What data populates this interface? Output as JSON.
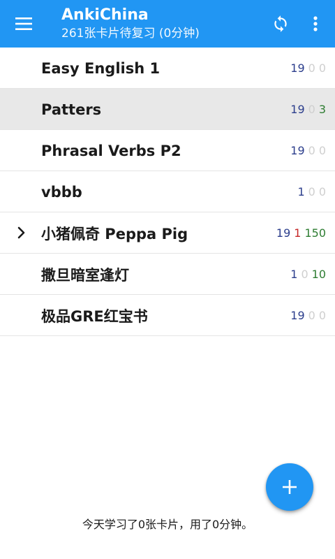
{
  "toolbar": {
    "title": "AnkiChina",
    "subtitle": "261张卡片待复习 (0分钟)",
    "color": "#2196f3"
  },
  "icons": {
    "menu": "hamburger-menu-icon",
    "sync": "sync-icon",
    "more": "more-vert-icon",
    "expand": "chevron-right-icon",
    "add": "plus-icon"
  },
  "decks": [
    {
      "name": "Easy English 1",
      "new": "19",
      "learn": "0",
      "review": "0",
      "selected": false,
      "expandable": false
    },
    {
      "name": "Patters",
      "new": "19",
      "learn": "0",
      "review": "3",
      "selected": true,
      "expandable": false
    },
    {
      "name": "Phrasal Verbs P2",
      "new": "19",
      "learn": "0",
      "review": "0",
      "selected": false,
      "expandable": false
    },
    {
      "name": "vbbb",
      "new": "1",
      "learn": "0",
      "review": "0",
      "selected": false,
      "expandable": false
    },
    {
      "name": "小猪佩奇 Peppa Pig",
      "new": "19",
      "learn": "1",
      "review": "150",
      "selected": false,
      "expandable": true
    },
    {
      "name": "撒旦暗室逢灯",
      "new": "1",
      "learn": "0",
      "review": "10",
      "selected": false,
      "expandable": false
    },
    {
      "name": "极品GRE红宝书",
      "new": "19",
      "learn": "0",
      "review": "0",
      "selected": false,
      "expandable": false
    }
  ],
  "footer": {
    "text": "今天学习了0张卡片，用了0分钟。"
  },
  "colors": {
    "new": "#2c3e8c",
    "learn": "#c62828",
    "review": "#2e7d32",
    "zero": "#cfcfcf"
  }
}
